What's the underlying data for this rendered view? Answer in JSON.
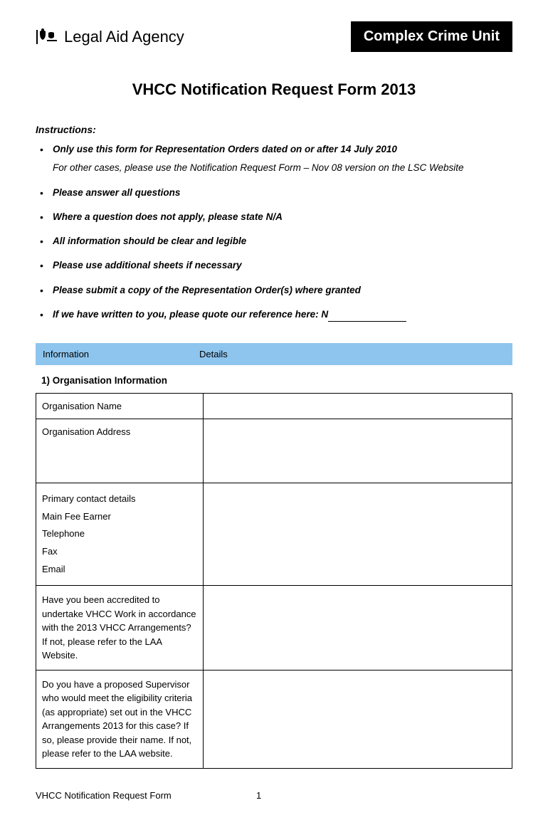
{
  "header": {
    "agency_name": "Legal Aid Agency",
    "unit_badge": "Complex Crime Unit"
  },
  "form_title": "VHCC Notification Request Form 2013",
  "instructions": {
    "label": "Instructions:",
    "items": [
      {
        "bold": "Only use this form for Representation Orders dated on or after 14 July 2010",
        "sub": "For other cases, please use the Notification Request Form – Nov 08 version on the LSC Website"
      },
      {
        "bold": "Please answer all questions"
      },
      {
        "bold": "Where a question does not apply, please state N/A"
      },
      {
        "bold": "All information should be clear and legible"
      },
      {
        "bold": "Please use additional sheets if necessary"
      },
      {
        "bold": "Please submit a copy of the Representation Order(s) where granted"
      },
      {
        "bold": "If we have written to you, please quote our reference here: N"
      }
    ]
  },
  "banner": {
    "col1": "Information",
    "col2": "Details"
  },
  "section1": {
    "heading": "1)   Organisation Information",
    "rows": {
      "org_name": "Organisation Name",
      "org_address": "Organisation Address",
      "contact_block": "Primary contact details\nMain Fee Earner\nTelephone\nFax\nEmail",
      "accredited": "Have you been accredited to undertake VHCC Work in accordance with the 2013 VHCC Arrangements?  If not, please refer to the LAA Website.",
      "supervisor": "Do you have a proposed Supervisor who would meet the eligibility criteria (as appropriate) set out in the VHCC Arrangements 2013 for this case?   If so, please provide their name.  If not, please refer to the LAA website."
    }
  },
  "footer": {
    "title": "VHCC Notification Request Form",
    "page": "1"
  }
}
